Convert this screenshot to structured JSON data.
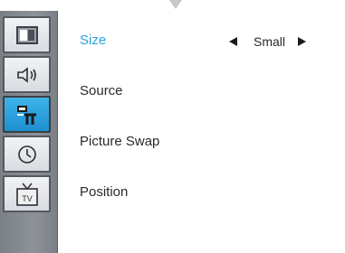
{
  "sidebar": {
    "items": [
      {
        "icon": "picture-icon",
        "active": false
      },
      {
        "icon": "sound-icon",
        "active": false
      },
      {
        "icon": "setup-icon",
        "active": true
      },
      {
        "icon": "clock-icon",
        "active": false
      },
      {
        "icon": "tv-icon",
        "active": false
      }
    ]
  },
  "menu": {
    "items": [
      {
        "label": "Size",
        "selected": true
      },
      {
        "label": "Source",
        "selected": false
      },
      {
        "label": "Picture Swap",
        "selected": false
      },
      {
        "label": "Position",
        "selected": false
      }
    ],
    "size_value": "Small"
  },
  "colors": {
    "selected_text": "#2aa3e0",
    "active_tab": "#1d8fd1"
  }
}
